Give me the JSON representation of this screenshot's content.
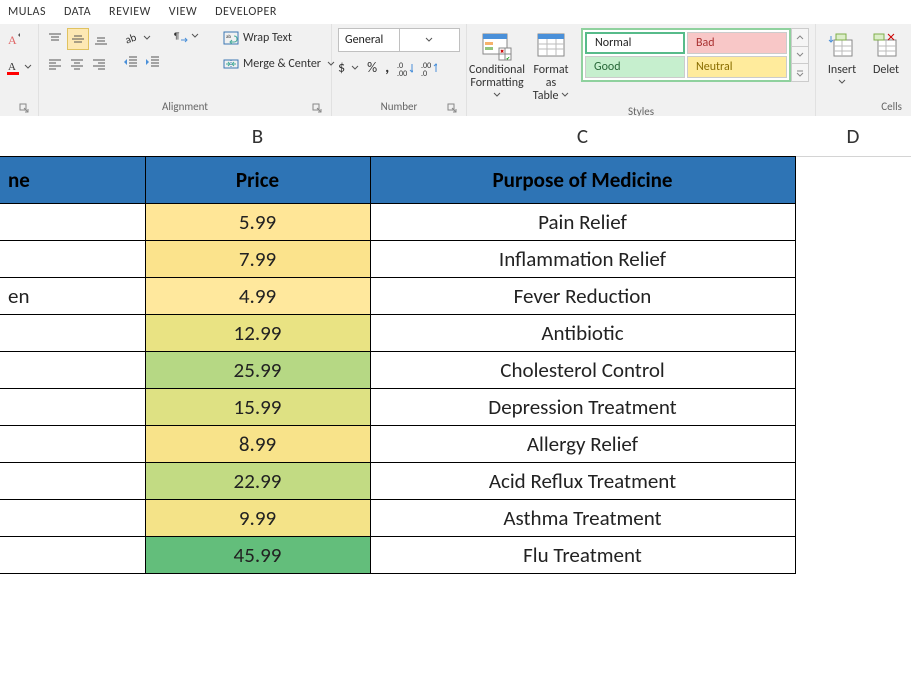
{
  "tabs": {
    "t0": "MULAS",
    "t1": "DATA",
    "t2": "REVIEW",
    "t3": "VIEW",
    "t4": "DEVELOPER"
  },
  "ribbon": {
    "wrap_text": "Wrap Text",
    "merge_center": "Merge & Center",
    "number_format": "General",
    "conditional_formatting_l1": "Conditional",
    "conditional_formatting_l2": "Formatting",
    "format_as_table_l1": "Format as",
    "format_as_table_l2": "Table",
    "style_normal": "Normal",
    "style_bad": "Bad",
    "style_good": "Good",
    "style_neutral": "Neutral",
    "insert": "Insert",
    "delete": "Delet",
    "group_alignment": "Alignment",
    "group_number": "Number",
    "group_styles": "Styles",
    "group_cells": "Cells"
  },
  "columns": {
    "A_partial": "",
    "B": "B",
    "C": "C",
    "D": "D"
  },
  "table": {
    "headers": {
      "a": "ne",
      "b": "Price",
      "c": "Purpose of Medicine"
    },
    "rows": [
      {
        "a": "",
        "price": "5.99",
        "purpose": "Pain Relief",
        "price_bg": "#ffe697"
      },
      {
        "a": "",
        "price": "7.99",
        "purpose": "Inflammation Relief",
        "price_bg": "#fbe38c"
      },
      {
        "a": "en",
        "price": "4.99",
        "purpose": "Fever Reduction",
        "price_bg": "#ffe89d"
      },
      {
        "a": "",
        "price": "12.99",
        "purpose": "Antibiotic",
        "price_bg": "#e9e383"
      },
      {
        "a": "",
        "price": "25.99",
        "purpose": "Cholesterol Control",
        "price_bg": "#b6d884"
      },
      {
        "a": "",
        "price": "15.99",
        "purpose": "Depression Treatment",
        "price_bg": "#dee183"
      },
      {
        "a": "",
        "price": "8.99",
        "purpose": "Allergy Relief",
        "price_bg": "#f8e38a"
      },
      {
        "a": "",
        "price": "22.99",
        "purpose": "Acid Reflux Treatment",
        "price_bg": "#c2db83"
      },
      {
        "a": "",
        "price": "9.99",
        "purpose": "Asthma Treatment",
        "price_bg": "#f4e388"
      },
      {
        "a": "",
        "price": "45.99",
        "purpose": "Flu Treatment",
        "price_bg": "#63be7b"
      }
    ]
  }
}
